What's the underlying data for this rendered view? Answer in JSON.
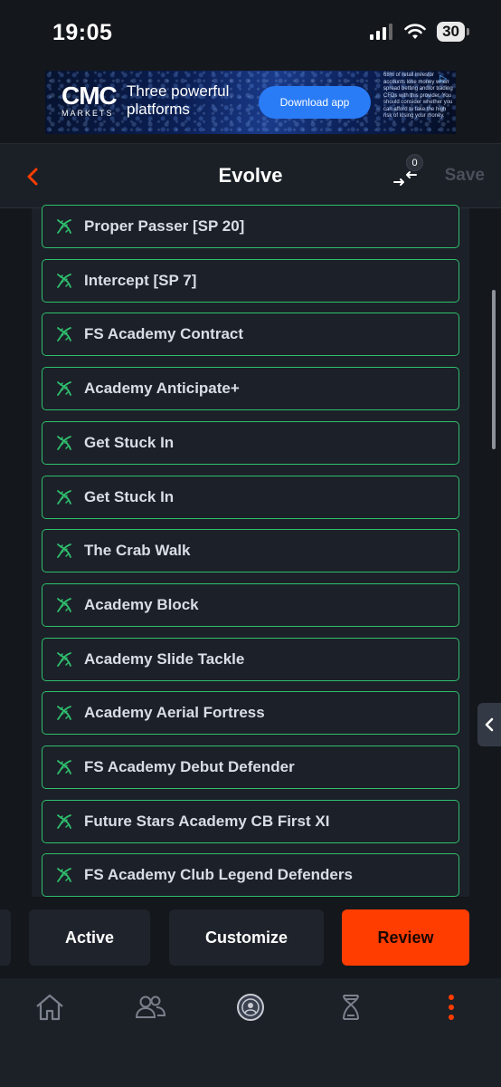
{
  "status_bar": {
    "time": "19:05",
    "battery": "30"
  },
  "ad": {
    "logo": "CMC",
    "logo_sub": "MARKETS",
    "tagline": "Three powerful platforms",
    "button": "Download app",
    "disclaimer": "68% of retail investor accounts lose money when spread betting and/or trading CFDs with this provider. You should consider whether you can afford to take the high risk of losing your money."
  },
  "header": {
    "title": "Evolve",
    "compare_count": "0",
    "save_label": "Save"
  },
  "evolutions": [
    "Proper Passer [SP 20]",
    "Intercept [SP 7]",
    "FS Academy Contract",
    "Academy Anticipate+",
    "Get Stuck In",
    "Get Stuck In",
    "The Crab Walk",
    "Academy Block",
    "Academy Slide Tackle",
    "Academy Aerial Fortress",
    "FS Academy Debut Defender",
    "Future Stars Academy CB First XI",
    "FS Academy Club Legend Defenders"
  ],
  "actions": {
    "active": "Active",
    "customize": "Customize",
    "review": "Review"
  },
  "nav": [
    "home-icon",
    "friends-icon",
    "club-badge-icon",
    "evolution-dna-icon",
    "more-icon"
  ],
  "colors": {
    "accent": "#ff3d00",
    "item_border": "#2fbf6e",
    "background": "#14171c"
  }
}
